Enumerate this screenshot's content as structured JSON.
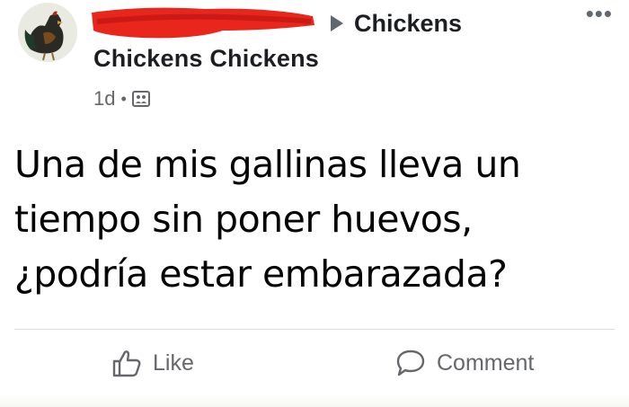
{
  "post": {
    "group_name": "Chickens",
    "author_line": "Chickens Chickens",
    "timestamp": "1d",
    "separator": "•",
    "privacy_icon": "group-privacy-icon",
    "more_label": "•••",
    "body_lines": [
      "Una de mis gallinas lleva un",
      "tiempo sin poner huevos,",
      "¿podría estar embarazada?"
    ]
  },
  "actions": {
    "like_label": "Like",
    "comment_label": "Comment",
    "like_icon": "thumbs-up-icon",
    "comment_icon": "speech-bubble-icon"
  },
  "colors": {
    "redaction": "#e8261c",
    "text_primary": "#050505",
    "text_secondary": "#65676b"
  }
}
